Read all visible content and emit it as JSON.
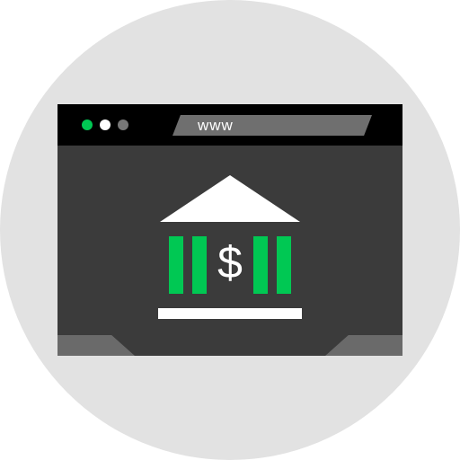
{
  "browser": {
    "address_text": "www",
    "window_controls": [
      "green-dot",
      "white-dot",
      "gray-dot"
    ]
  },
  "content": {
    "icon": "bank-icon",
    "currency_symbol": "$"
  },
  "colors": {
    "background_circle": "#e2e2e2",
    "window_body": "#3b3b3b",
    "titlebar": "#000000",
    "address_bar": "#6f6f6f",
    "accent_green": "#00c853",
    "white": "#ffffff"
  }
}
